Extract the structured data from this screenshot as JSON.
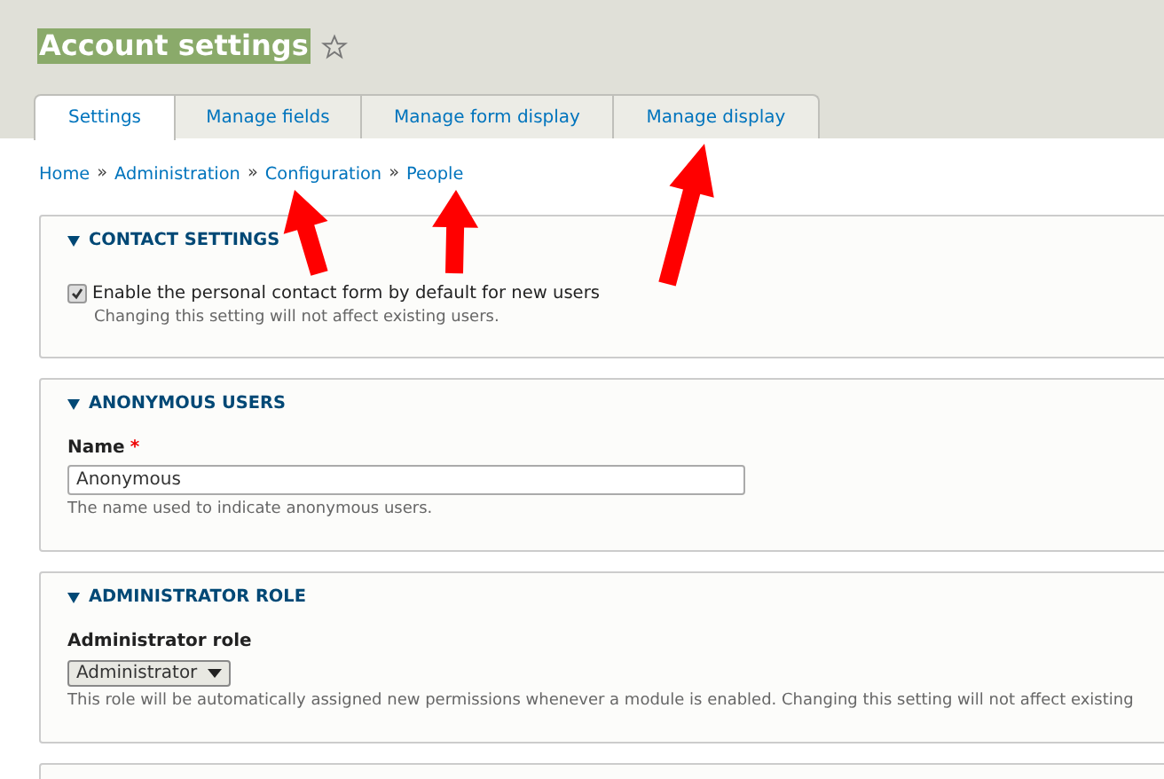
{
  "page_title": "Account settings",
  "tabs": [
    {
      "label": "Settings",
      "selected": true
    },
    {
      "label": "Manage fields",
      "selected": false
    },
    {
      "label": "Manage form display",
      "selected": false
    },
    {
      "label": "Manage display",
      "selected": false
    }
  ],
  "breadcrumb": [
    "Home",
    "Administration",
    "Configuration",
    "People"
  ],
  "breadcrumb_separator": "»",
  "sections": [
    {
      "title": "CONTACT SETTINGS",
      "expanded": true,
      "kind": "checkbox",
      "label": "Enable the personal contact form by default for new users",
      "checked": true,
      "description": "Changing this setting will not affect existing users."
    },
    {
      "title": "ANONYMOUS USERS",
      "expanded": true,
      "kind": "text",
      "label": "Name",
      "required": true,
      "required_mark": "*",
      "value": "Anonymous",
      "description": "The name used to indicate anonymous users."
    },
    {
      "title": "ADMINISTRATOR ROLE",
      "expanded": true,
      "kind": "select",
      "label": "Administrator role",
      "value": "Administrator",
      "description": "This role will be automatically assigned new permissions whenever a module is enabled. Changing this setting will not affect existing"
    }
  ]
}
